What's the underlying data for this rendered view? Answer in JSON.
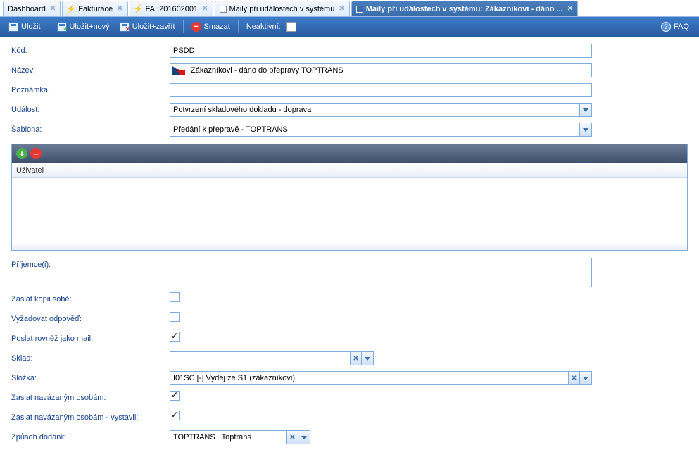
{
  "tabs": [
    {
      "label": "Dashboard",
      "active": false,
      "icon": "none"
    },
    {
      "label": "Fakturace",
      "active": false,
      "icon": "red"
    },
    {
      "label": "FA: 201602001",
      "active": false,
      "icon": "red"
    },
    {
      "label": "Maily při událostech v systému",
      "active": false,
      "icon": "box"
    },
    {
      "label": "Maily při událostech v systému: Zákazníkovi - dáno ...",
      "active": true,
      "icon": "box-blue"
    }
  ],
  "toolbar": {
    "save": "Uložit",
    "save_new": "Uložit+nový",
    "save_close": "Uložit+zavřít",
    "delete": "Smazat",
    "inactive": "Neaktivní:",
    "faq": "FAQ"
  },
  "form": {
    "code_lbl": "Kód:",
    "code_val": "PSDD",
    "name_lbl": "Název:",
    "name_val": "Zákazníkovi - dáno do přepravy TOPTRANS",
    "note_lbl": "Poznámka:",
    "note_val": "",
    "event_lbl": "Událost:",
    "event_val": "Potvrzení skladového dokladu - doprava",
    "tpl_lbl": "Šablona:",
    "tpl_val": "Předání k přepravě - TOPTRANS",
    "grid_col": "Uživatel",
    "recip_lbl": "Příjemce(i):",
    "recip_val": "",
    "cc_lbl": "Zaslat kopii sobě:",
    "reply_lbl": "Vyžadovat odpověď:",
    "also_mail_lbl": "Poslat rovněž jako mail:",
    "wh_lbl": "Sklad:",
    "wh_val": "",
    "folder_lbl": "Složka:",
    "folder_val": "I01SC [-] Výdej ze S1 (zákazníkovi)",
    "linked_lbl": "Zaslat navázaným osobám:",
    "linked_iss_lbl": "Zaslat navázaným osobám - vystavil:",
    "delivery_lbl": "Způsob dodání:",
    "delivery_val": "TOPTRANS   Toptrans"
  }
}
